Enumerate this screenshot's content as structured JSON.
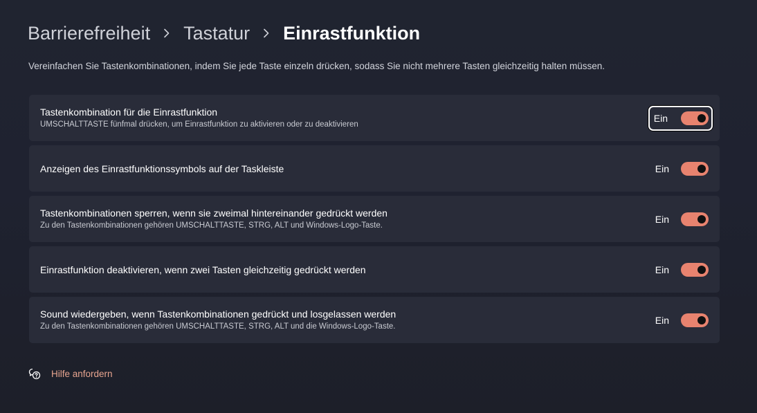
{
  "breadcrumb": {
    "items": [
      "Barrierefreiheit",
      "Tastatur"
    ],
    "current": "Einrastfunktion"
  },
  "description": "Vereinfachen Sie Tastenkombinationen, indem Sie jede Taste einzeln drücken, sodass Sie nicht mehrere Tasten gleichzeitig halten müssen.",
  "settings": [
    {
      "title": "Tastenkombination für die Einrastfunktion",
      "subtitle": "UMSCHALTTASTE fünfmal drücken, um Einrastfunktion zu aktivieren oder zu deaktivieren",
      "state_label": "Ein",
      "on": true,
      "focused": true
    },
    {
      "title": "Anzeigen des Einrastfunktionssymbols auf der Taskleiste",
      "subtitle": "",
      "state_label": "Ein",
      "on": true
    },
    {
      "title": "Tastenkombinationen sperren, wenn sie zweimal hintereinander gedrückt werden",
      "subtitle": "Zu den Tastenkombinationen gehören UMSCHALTTASTE, STRG, ALT und Windows-Logo-Taste.",
      "state_label": "Ein",
      "on": true
    },
    {
      "title": "Einrastfunktion deaktivieren, wenn zwei Tasten gleichzeitig gedrückt werden",
      "subtitle": "",
      "state_label": "Ein",
      "on": true
    },
    {
      "title": "Sound wiedergeben, wenn Tastenkombinationen gedrückt und losgelassen werden",
      "subtitle": "Zu den Tastenkombinationen gehören UMSCHALTTASTE, STRG, ALT und die Windows-Logo-Taste.",
      "state_label": "Ein",
      "on": true
    }
  ],
  "help": {
    "label": "Hilfe anfordern",
    "icon": "help-chat-icon"
  },
  "colors": {
    "accent": "#e8836f",
    "link": "#e8a58f",
    "card": "#292c39"
  }
}
